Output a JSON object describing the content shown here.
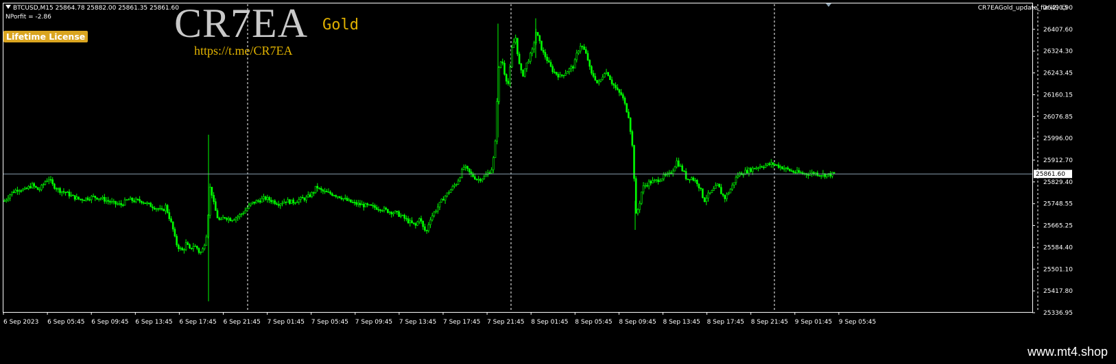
{
  "header": {
    "symbol_line": "BTCUSD,M15  25864.78 25882.00 25861.35 25861.60",
    "nprofit": "NPorfit = -2.86",
    "license_badge": "Lifetime License",
    "brand_title": "CR7EA",
    "brand_subtitle": "Gold",
    "brand_link": "https://t.me/CR7EA",
    "ea_name": "CR7EAGold_update_fix (2)",
    "ea_status_icon": "smiley-icon"
  },
  "footer": {
    "watermark": "www.mt4.shop"
  },
  "colors": {
    "background": "#000000",
    "candle": "#00ff00",
    "grid": "#ffffff",
    "price_line": "#8aa0b0",
    "badge": "#daa520"
  },
  "chart_data": {
    "type": "candlestick",
    "symbol": "BTCUSD",
    "timeframe": "M15",
    "current_price": 25861.6,
    "current_price_label": "25861.60",
    "y_ticks": [
      "26490.90",
      "26407.60",
      "26324.30",
      "26243.45",
      "26160.15",
      "26076.85",
      "25996.00",
      "25912.70",
      "25829.40",
      "25748.55",
      "25665.25",
      "25584.40",
      "25501.10",
      "25417.80",
      "25336.95"
    ],
    "ylim": [
      25336.95,
      26490.9
    ],
    "x_ticks": [
      "6 Sep 2023",
      "6 Sep 05:45",
      "6 Sep 09:45",
      "6 Sep 13:45",
      "6 Sep 17:45",
      "6 Sep 21:45",
      "7 Sep 01:45",
      "7 Sep 05:45",
      "7 Sep 09:45",
      "7 Sep 13:45",
      "7 Sep 17:45",
      "7 Sep 21:45",
      "8 Sep 01:45",
      "8 Sep 05:45",
      "8 Sep 09:45",
      "8 Sep 13:45",
      "8 Sep 17:45",
      "8 Sep 21:45",
      "9 Sep 01:45",
      "9 Sep 05:45"
    ],
    "day_separators": [
      "7 Sep 00:00",
      "8 Sep 00:00",
      "9 Sep 00:00"
    ],
    "price_path": [
      [
        0,
        25760
      ],
      [
        10,
        25790
      ],
      [
        20,
        25805
      ],
      [
        30,
        25800
      ],
      [
        40,
        25820
      ],
      [
        50,
        25800
      ],
      [
        55,
        25815
      ],
      [
        60,
        25835
      ],
      [
        65,
        25845
      ],
      [
        70,
        25820
      ],
      [
        80,
        25800
      ],
      [
        90,
        25790
      ],
      [
        100,
        25775
      ],
      [
        110,
        25765
      ],
      [
        120,
        25770
      ],
      [
        130,
        25775
      ],
      [
        140,
        25770
      ],
      [
        150,
        25760
      ],
      [
        160,
        25750
      ],
      [
        170,
        25745
      ],
      [
        180,
        25765
      ],
      [
        190,
        25760
      ],
      [
        200,
        25760
      ],
      [
        210,
        25745
      ],
      [
        220,
        25735
      ],
      [
        230,
        25720
      ],
      [
        235,
        25740
      ],
      [
        240,
        25700
      ],
      [
        245,
        25660
      ],
      [
        250,
        25600
      ],
      [
        255,
        25580
      ],
      [
        260,
        25570
      ],
      [
        265,
        25600
      ],
      [
        270,
        25575
      ],
      [
        275,
        25590
      ],
      [
        280,
        25585
      ],
      [
        285,
        25560
      ],
      [
        290,
        25580
      ],
      [
        295,
        25640
      ],
      [
        300,
        25820
      ],
      [
        305,
        25750
      ],
      [
        310,
        25700
      ],
      [
        315,
        25680
      ],
      [
        320,
        25700
      ],
      [
        330,
        25690
      ],
      [
        340,
        25700
      ],
      [
        350,
        25720
      ],
      [
        360,
        25750
      ],
      [
        370,
        25760
      ],
      [
        380,
        25770
      ],
      [
        390,
        25760
      ],
      [
        400,
        25750
      ],
      [
        410,
        25760
      ],
      [
        420,
        25755
      ],
      [
        430,
        25765
      ],
      [
        440,
        25770
      ],
      [
        450,
        25790
      ],
      [
        455,
        25815
      ],
      [
        460,
        25800
      ],
      [
        470,
        25790
      ],
      [
        480,
        25785
      ],
      [
        490,
        25775
      ],
      [
        500,
        25760
      ],
      [
        510,
        25750
      ],
      [
        520,
        25745
      ],
      [
        530,
        25740
      ],
      [
        540,
        25735
      ],
      [
        550,
        25730
      ],
      [
        560,
        25720
      ],
      [
        570,
        25715
      ],
      [
        580,
        25700
      ],
      [
        590,
        25680
      ],
      [
        600,
        25665
      ],
      [
        605,
        25700
      ],
      [
        610,
        25660
      ],
      [
        615,
        25640
      ],
      [
        620,
        25690
      ],
      [
        630,
        25730
      ],
      [
        640,
        25770
      ],
      [
        650,
        25800
      ],
      [
        660,
        25830
      ],
      [
        670,
        25890
      ],
      [
        680,
        25860
      ],
      [
        690,
        25840
      ],
      [
        700,
        25850
      ],
      [
        710,
        25880
      ],
      [
        715,
        25950
      ],
      [
        720,
        26250
      ],
      [
        725,
        26300
      ],
      [
        730,
        26230
      ],
      [
        735,
        26200
      ],
      [
        740,
        26340
      ],
      [
        745,
        26380
      ],
      [
        750,
        26280
      ],
      [
        755,
        26230
      ],
      [
        760,
        26270
      ],
      [
        765,
        26300
      ],
      [
        770,
        26330
      ],
      [
        775,
        26400
      ],
      [
        780,
        26360
      ],
      [
        785,
        26320
      ],
      [
        790,
        26300
      ],
      [
        795,
        26270
      ],
      [
        800,
        26250
      ],
      [
        810,
        26230
      ],
      [
        820,
        26250
      ],
      [
        830,
        26270
      ],
      [
        835,
        26320
      ],
      [
        840,
        26350
      ],
      [
        845,
        26330
      ],
      [
        850,
        26300
      ],
      [
        855,
        26240
      ],
      [
        860,
        26230
      ],
      [
        865,
        26200
      ],
      [
        870,
        26220
      ],
      [
        875,
        26250
      ],
      [
        880,
        26240
      ],
      [
        885,
        26210
      ],
      [
        890,
        26190
      ],
      [
        895,
        26170
      ],
      [
        900,
        26160
      ],
      [
        905,
        26120
      ],
      [
        910,
        26080
      ],
      [
        915,
        25980
      ],
      [
        918,
        25850
      ],
      [
        920,
        25700
      ],
      [
        925,
        25740
      ],
      [
        930,
        25810
      ],
      [
        940,
        25830
      ],
      [
        950,
        25835
      ],
      [
        960,
        25850
      ],
      [
        970,
        25860
      ],
      [
        975,
        25880
      ],
      [
        980,
        25910
      ],
      [
        985,
        25890
      ],
      [
        990,
        25870
      ],
      [
        995,
        25840
      ],
      [
        1000,
        25850
      ],
      [
        1010,
        25830
      ],
      [
        1015,
        25800
      ],
      [
        1020,
        25760
      ],
      [
        1025,
        25780
      ],
      [
        1030,
        25790
      ],
      [
        1040,
        25820
      ],
      [
        1045,
        25790
      ],
      [
        1050,
        25770
      ],
      [
        1055,
        25790
      ],
      [
        1060,
        25810
      ],
      [
        1065,
        25840
      ],
      [
        1070,
        25860
      ],
      [
        1080,
        25870
      ],
      [
        1090,
        25880
      ],
      [
        1100,
        25890
      ],
      [
        1110,
        25895
      ],
      [
        1120,
        25900
      ],
      [
        1130,
        25890
      ],
      [
        1140,
        25880
      ],
      [
        1150,
        25870
      ],
      [
        1160,
        25865
      ],
      [
        1170,
        25862
      ],
      [
        1180,
        25865
      ],
      [
        1190,
        25860
      ],
      [
        1200,
        25858
      ],
      [
        1210,
        25862
      ]
    ]
  }
}
